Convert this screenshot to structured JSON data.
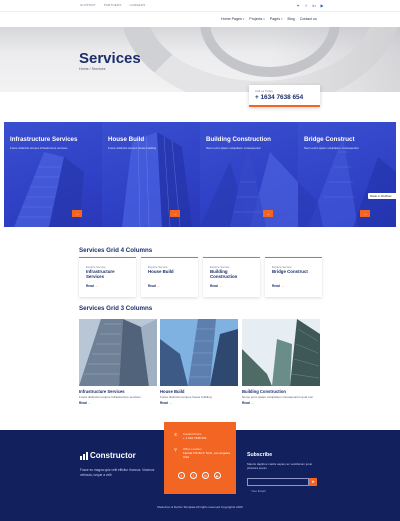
{
  "topbar": {
    "links": [
      "SUPPORT",
      "PARTNERS",
      "CAREERS"
    ],
    "socials": [
      "twitter-icon",
      "facebook-icon",
      "linkedin-icon",
      "youtube-icon"
    ]
  },
  "nav": {
    "items": [
      {
        "label": "Home Pages",
        "has_caret": true
      },
      {
        "label": "Projects",
        "has_caret": true
      },
      {
        "label": "Pages",
        "has_caret": true
      },
      {
        "label": "Blog",
        "has_caret": false
      },
      {
        "label": "Contact us",
        "has_caret": false
      }
    ]
  },
  "hero": {
    "title": "Services",
    "breadcrumb": "Home / Services"
  },
  "call": {
    "label": "Call us Today",
    "phone": "+ 1634 7638 654"
  },
  "panels": [
    {
      "title": "Infrastructure Services",
      "desc": "Fusce distinctio tempus infrastructure services"
    },
    {
      "title": "House Build",
      "desc": "Fusce distinctio tempus house building"
    },
    {
      "title": "Building Construction",
      "desc": "Nemo enim ipsam voluptatem consequuntur"
    },
    {
      "title": "Bridge Construct",
      "desc": "Nemo enim ipsam voluptatem consequuntur"
    }
  ],
  "panel_button": "→",
  "badge": "Made in Webflow",
  "grid4": {
    "title": "Services Grid 4 Columns",
    "category": "Explore Service",
    "read_more": "Read",
    "cards": [
      {
        "name": "Infrastructure Services"
      },
      {
        "name": "House Build"
      },
      {
        "name": "Building Construction"
      },
      {
        "name": "Bridge Construct"
      }
    ]
  },
  "grid3": {
    "title": "Services Grid 3 Columns",
    "read_more": "Read",
    "cards": [
      {
        "title": "Infrastructure Services",
        "desc": "Fusce distinctio tempus Infrastructure services"
      },
      {
        "title": "House Build",
        "desc": "Fusce distinctio tempus house building"
      },
      {
        "title": "Building Construction",
        "desc": "Nemo enim ipsam voluptatem consequuntur quia non"
      }
    ]
  },
  "footer": {
    "logo": "Constructor",
    "about": "Fusce eu magna quis velit efficitur rhoncus. Vivamus vehicula, neque a velit",
    "contact": {
      "phone_label": "Contact Phone",
      "phone": "+ 1 634 7638 654",
      "address_label": "Office Location",
      "address": "Florida FIS 82 P. M.St, Los Angeles USA"
    },
    "socials": [
      "twitter-icon",
      "facebook-icon",
      "linkedin-icon",
      "youtube-icon"
    ],
    "subscribe_title": "Subscribe",
    "subscribe_text": "Mauris dapibus mattis sapien ac vestibulum justo pharetra ipsum",
    "email_placeholder": "Your Email",
    "copyright": "Meduzion & Dezitu Template All rights reserved Copyrights 2020"
  },
  "colors": {
    "navy": "#1c2e6b",
    "footer_bg": "#12205e",
    "accent_orange": "#f26522",
    "panel_blue": "#3a4fd0",
    "link_blue": "#2b5bd6"
  }
}
